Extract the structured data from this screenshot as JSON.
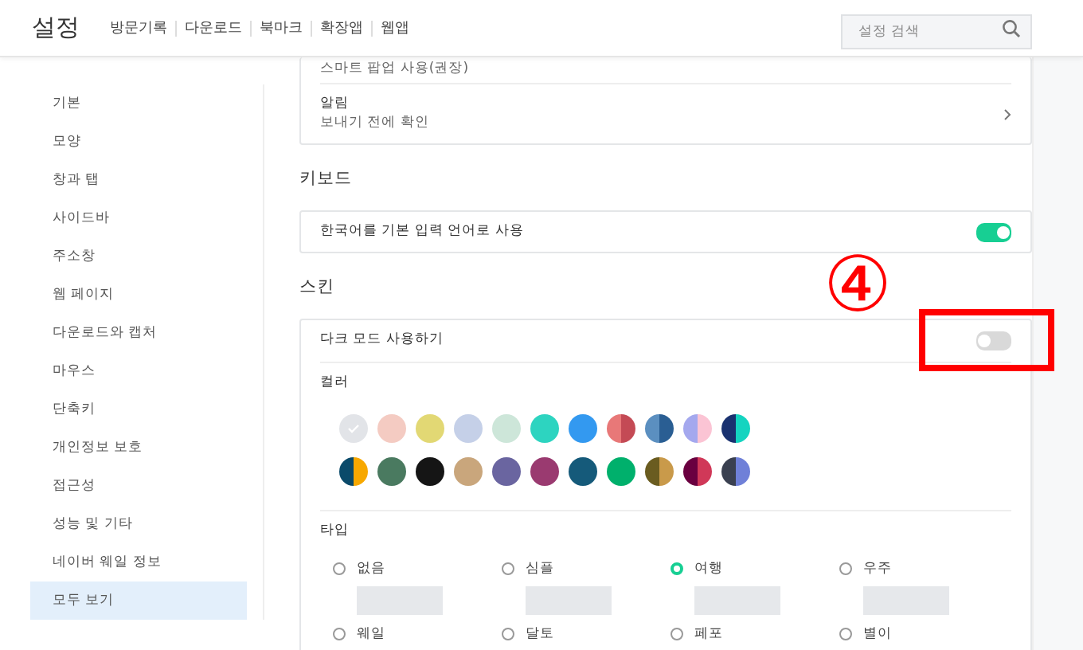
{
  "header": {
    "title": "설정",
    "links": [
      "방문기록",
      "다운로드",
      "북마크",
      "확장앱",
      "웹앱"
    ],
    "search": {
      "placeholder": "설정 검색"
    }
  },
  "sidebar": {
    "items": [
      {
        "label": "기본",
        "selected": false
      },
      {
        "label": "모양",
        "selected": false
      },
      {
        "label": "창과 탭",
        "selected": false
      },
      {
        "label": "사이드바",
        "selected": false
      },
      {
        "label": "주소창",
        "selected": false
      },
      {
        "label": "웹 페이지",
        "selected": false
      },
      {
        "label": "다운로드와 캡처",
        "selected": false
      },
      {
        "label": "마우스",
        "selected": false
      },
      {
        "label": "단축키",
        "selected": false
      },
      {
        "label": "개인정보 보호",
        "selected": false
      },
      {
        "label": "접근성",
        "selected": false
      },
      {
        "label": "성능 및 기타",
        "selected": false
      },
      {
        "label": "네이버 웨일 정보",
        "selected": false
      },
      {
        "label": "모두 보기",
        "selected": true
      }
    ]
  },
  "notifications_card": {
    "top_row": "스마트 팝업 사용(권장)",
    "title": "알림",
    "subtitle": "보내기 전에 확인"
  },
  "keyboard": {
    "heading": "키보드",
    "label": "한국어를 기본 입력 언어로 사용",
    "on": true
  },
  "skin": {
    "heading": "스킨",
    "dark_mode": {
      "label": "다크 모드 사용하기",
      "on": false
    },
    "color_label": "컬러",
    "colors": [
      {
        "halves": [
          {
            "color": "#e2e4e8"
          }
        ],
        "selected": true
      },
      {
        "halves": [
          {
            "color": "#f4cbc2"
          }
        ],
        "selected": false
      },
      {
        "halves": [
          {
            "color": "#e2d874"
          }
        ],
        "selected": false
      },
      {
        "halves": [
          {
            "color": "#c5d0e8"
          }
        ],
        "selected": false
      },
      {
        "halves": [
          {
            "color": "#cde6d9"
          }
        ],
        "selected": false
      },
      {
        "halves": [
          {
            "color": "#2dd4c0"
          }
        ],
        "selected": false
      },
      {
        "halves": [
          {
            "color": "#3399f0"
          }
        ],
        "selected": false
      },
      {
        "halves": [
          {
            "color": "#e87878"
          },
          {
            "color": "#c44a55"
          }
        ],
        "selected": false
      },
      {
        "halves": [
          {
            "color": "#5b8fc0"
          },
          {
            "color": "#2a5e93"
          }
        ],
        "selected": false
      },
      {
        "halves": [
          {
            "color": "#a4a8ee"
          },
          {
            "color": "#fbc4d4"
          }
        ],
        "selected": false
      },
      {
        "halves": [
          {
            "color": "#1a3270"
          },
          {
            "color": "#14d4c0"
          }
        ],
        "selected": false
      },
      {
        "halves": [
          {
            "color": "#0a4a6a"
          },
          {
            "color": "#f7a800"
          }
        ],
        "selected": false
      },
      {
        "halves": [
          {
            "color": "#4a7a60"
          }
        ],
        "selected": false
      },
      {
        "halves": [
          {
            "color": "#151515"
          }
        ],
        "selected": false
      },
      {
        "halves": [
          {
            "color": "#c9a67c"
          }
        ],
        "selected": false
      },
      {
        "halves": [
          {
            "color": "#6a65a0"
          }
        ],
        "selected": false
      },
      {
        "halves": [
          {
            "color": "#9a3a70"
          }
        ],
        "selected": false
      },
      {
        "halves": [
          {
            "color": "#155a7a"
          }
        ],
        "selected": false
      },
      {
        "halves": [
          {
            "color": "#00b06c"
          }
        ],
        "selected": false
      },
      {
        "halves": [
          {
            "color": "#6a5c20"
          },
          {
            "color": "#c99a4a"
          }
        ],
        "selected": false
      },
      {
        "halves": [
          {
            "color": "#6a0040"
          },
          {
            "color": "#d03858"
          }
        ],
        "selected": false
      },
      {
        "halves": [
          {
            "color": "#3a4050"
          },
          {
            "color": "#6f80d8"
          }
        ],
        "selected": false
      }
    ],
    "type_label": "타입",
    "types": [
      {
        "label": "없음",
        "selected": false
      },
      {
        "label": "심플",
        "selected": false
      },
      {
        "label": "여행",
        "selected": true
      },
      {
        "label": "우주",
        "selected": false
      },
      {
        "label": "웨일",
        "selected": false
      },
      {
        "label": "달토",
        "selected": false
      },
      {
        "label": "페포",
        "selected": false
      },
      {
        "label": "별이",
        "selected": false
      }
    ]
  },
  "annotation": {
    "marker": "④"
  }
}
